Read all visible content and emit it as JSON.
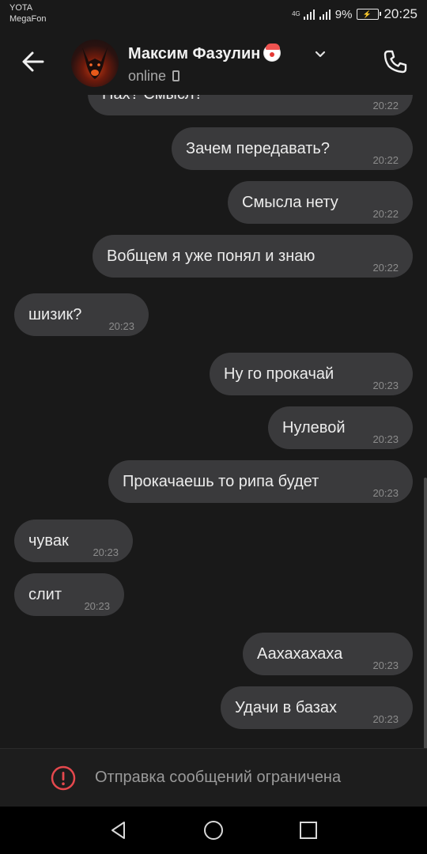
{
  "status_bar": {
    "carrier1": "YOTA",
    "carrier2": "MegaFon",
    "network": "4G",
    "battery": "9%",
    "time": "20:25"
  },
  "header": {
    "contact_name": "Максим Фазулин",
    "status": "online",
    "icons": [
      "back-arrow-icon",
      "clown-emoji-icon",
      "chevron-down-icon",
      "mobile-device-icon",
      "phone-icon"
    ]
  },
  "messages": [
    {
      "side": "out",
      "text": "Нах? Смысл?",
      "time": "20:22"
    },
    {
      "side": "out",
      "text": "Зачем передавать?",
      "time": "20:22"
    },
    {
      "side": "out",
      "text": "Смысла нету",
      "time": "20:22"
    },
    {
      "side": "out",
      "text": "Вобщем я уже понял и знаю",
      "time": "20:22"
    },
    {
      "side": "in",
      "text": "шизик?",
      "time": "20:23"
    },
    {
      "side": "out",
      "text": "Ну го прокачай",
      "time": "20:23"
    },
    {
      "side": "out",
      "text": "Нулевой",
      "time": "20:23"
    },
    {
      "side": "out",
      "text": "Прокачаешь то рипа будет",
      "time": "20:23"
    },
    {
      "side": "in",
      "text": "чувак",
      "time": "20:23"
    },
    {
      "side": "in",
      "text": "слит",
      "time": "20:23"
    },
    {
      "side": "out",
      "text": "Аахахахаха",
      "time": "20:23"
    },
    {
      "side": "out",
      "text": "Удачи в базах",
      "time": "20:23"
    }
  ],
  "restricted_notice": "Отправка сообщений ограничена",
  "colors": {
    "background": "#191919",
    "bubble": "#3a3a3c",
    "warning": "#e5484d"
  }
}
